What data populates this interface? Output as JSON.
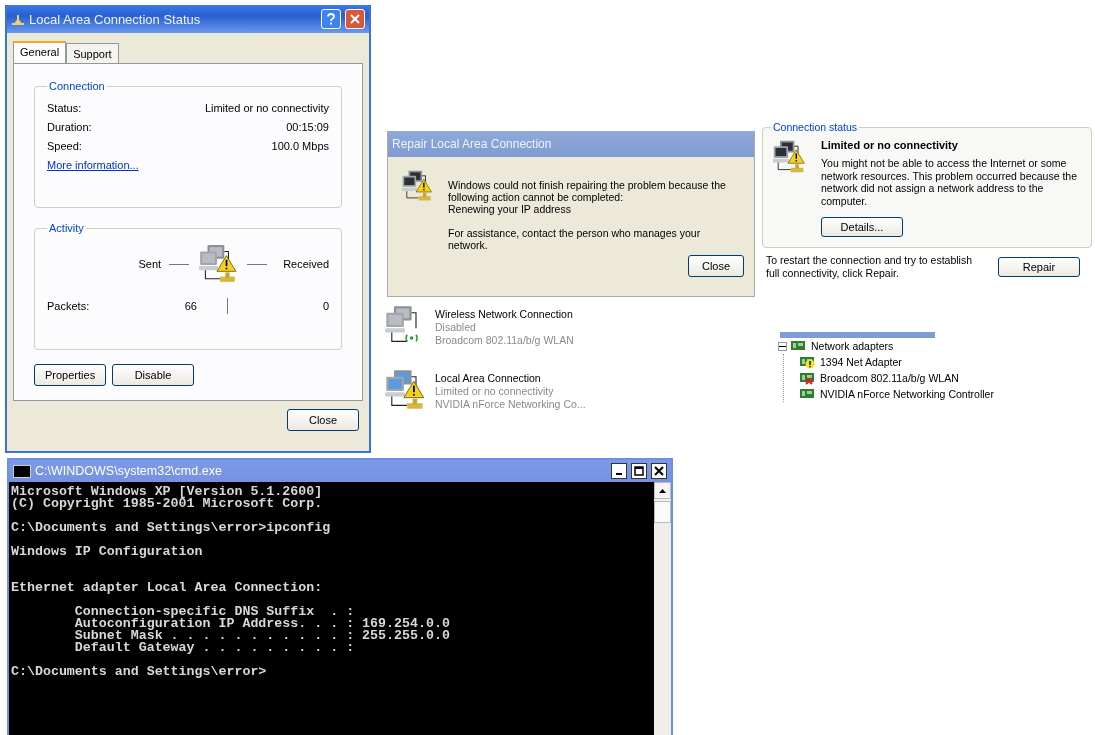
{
  "status_dialog": {
    "title": "Local Area Connection Status",
    "tabs": [
      {
        "label": "General",
        "selected": true
      },
      {
        "label": "Support",
        "selected": false
      }
    ],
    "connection_group": {
      "label": "Connection",
      "rows": [
        {
          "label": "Status:",
          "value": "Limited or no connectivity"
        },
        {
          "label": "Duration:",
          "value": "00:15:09"
        },
        {
          "label": "Speed:",
          "value": "100.0 Mbps"
        }
      ],
      "link": "More information..."
    },
    "activity_group": {
      "label": "Activity",
      "sent_label": "Sent",
      "received_label": "Received",
      "packets_label": "Packets:",
      "sent_value": "66",
      "received_value": "0"
    },
    "buttons": [
      "Properties",
      "Disable"
    ],
    "close_button": "Close"
  },
  "repair_dialog": {
    "title": "Repair Local Area Connection",
    "message": [
      "Windows could not finish repairing the problem because the following action cannot be completed:",
      "Renewing your IP address"
    ],
    "assistance": "For assistance, contact the person who manages your network.",
    "close_button": "Close"
  },
  "connection_status": {
    "group_label": "Connection status",
    "heading": "Limited or no connectivity",
    "description": "You might not be able to access the Internet or some network resources. This problem occurred because the network did not assign a network address to the computer.",
    "details_button": "Details...",
    "repair_hint": "To restart the connection and try to establish full connectivity, click Repair.",
    "repair_button": "Repair"
  },
  "network_connections": [
    {
      "kind": "wireless",
      "name": "Wireless Network Connection",
      "status": "Disabled",
      "device": "Broadcom 802.11a/b/g WLAN"
    },
    {
      "kind": "lan",
      "name": "Local Area Connection",
      "status": "Limited or no connectivity",
      "device": "NVIDIA nForce Networking Co..."
    }
  ],
  "device_tree": {
    "label": "Network adapters",
    "expanded": true,
    "children": [
      {
        "kind": "warning",
        "name": "1394 Net Adapter"
      },
      {
        "kind": "disabled",
        "name": "Broadcom 802.11a/b/g WLAN"
      },
      {
        "kind": "ok",
        "name": "NVIDIA nForce Networking Controller"
      }
    ]
  },
  "console": {
    "title": "C:\\WINDOWS\\system32\\cmd.exe",
    "blocks": [
      [
        "Microsoft Windows XP [Version 5.1.2600]",
        "(C) Copyright 1985-2001 Microsoft Corp."
      ],
      [
        "C:\\Documents and Settings\\error>ipconfig"
      ],
      [
        "Windows IP Configuration"
      ],
      [
        "Ethernet adapter Local Area Connection:"
      ],
      [
        "        Connection-specific DNS Suffix  . :",
        "        Autoconfiguration IP Address. . . : 169.254.0.0",
        "        Subnet Mask . . . . . . . . . . . : 255.255.0.0",
        "        Default Gateway . . . . . . . . . :"
      ],
      [
        "C:\\Documents and Settings\\error>"
      ]
    ]
  }
}
